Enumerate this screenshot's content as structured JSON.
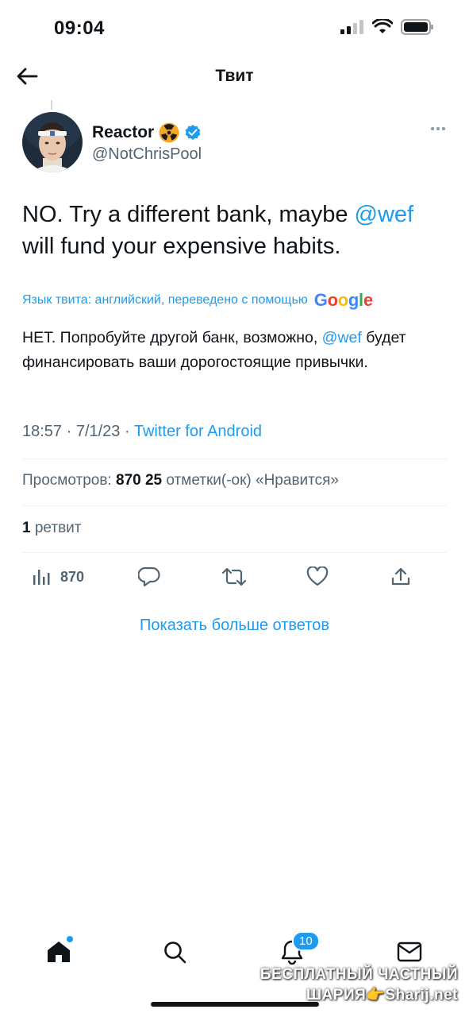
{
  "status_bar": {
    "time": "09:04"
  },
  "header": {
    "title": "Твит"
  },
  "tweet": {
    "author_name": "Reactor",
    "author_emoji": "☢",
    "handle": "@NotChrisPool",
    "text_before_mention": "NO. Try a different bank, maybe ",
    "mention": "@wef",
    "text_after_mention": " will fund your expensive habits.",
    "translation_note": "Язык твита: английский, переведено с помощью",
    "translation_provider": "Google",
    "translated_before_mention": "НЕТ. Попробуйте другой банк, возможно, ",
    "translated_mention": "@wef",
    "translated_after_mention": " будет финансировать ваши дорогостоящие привычки.",
    "timestamp": "18:57 · 7/1/23 · ",
    "source": "Twitter for Android",
    "views_label": "Просмотров:",
    "views_count": "870",
    "likes_count": "25",
    "likes_label": "отметки(-ок) «Нравится»",
    "retweets_count": "1",
    "retweets_label": "ретвит"
  },
  "actions": {
    "views_count": "870"
  },
  "show_more_replies": "Показать больше ответов",
  "tab_bar": {
    "notifications_badge": "10"
  },
  "watermark": {
    "line1": "БЕСПЛАТНЫЙ ЧАСТНЫЙ",
    "line2": "ШАРИЯ👉Sharij.net"
  },
  "colors": {
    "accent": "#1d9bf0",
    "text_primary": "#0f1419",
    "text_secondary": "#536471"
  }
}
